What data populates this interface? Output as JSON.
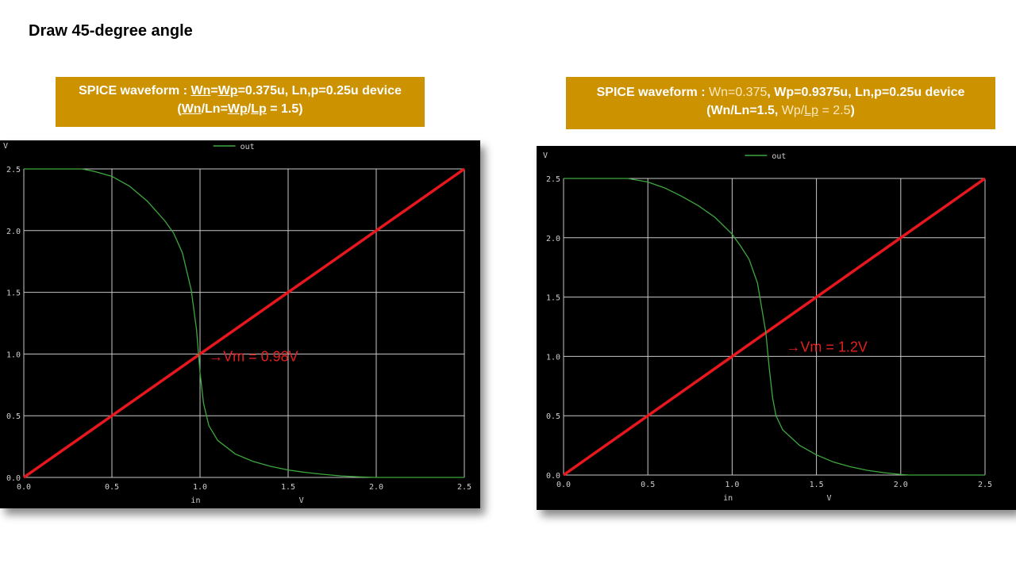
{
  "slide": {
    "title": "Draw 45-degree angle"
  },
  "captions": [
    {
      "line1_label": "SPICE waveform :",
      "line1_underlined": "Wn",
      "line1_mid": "=",
      "line1_underlined2": "Wp",
      "line1_rest": "=0.375u, Ln,p=0.25u device",
      "line2_open": "(",
      "line2_u1": "Wn",
      "line2_mid1": "/Ln=",
      "line2_u2": "Wp",
      "line2_mid2": "/",
      "line2_u3": "Lp",
      "line2_rest": " = 1.5)"
    },
    {
      "line1_label": "SPICE waveform :",
      "line1_light": " Wn=0.375",
      "line1_rest": ", Wp=0.9375u, Ln,p=0.25u device",
      "line2_a": "(Wn/Ln=1.5, ",
      "line2_light": "Wp/",
      "line2_u": "Lp",
      "line2_light2": " = 2.5",
      "line2_close": ")"
    }
  ],
  "colors": {
    "curve": "#3da83d",
    "diagonal": "#e8171e",
    "grid": "#c8c8c8",
    "background": "#000000",
    "caption_bg": "#cc9200"
  },
  "chart_data": [
    {
      "type": "line",
      "y_unit_label": "V",
      "x_unit_label": "V",
      "xlabel": "in",
      "legend": "out",
      "xlim": [
        0,
        2.5
      ],
      "ylim": [
        0,
        2.5
      ],
      "xticks": [
        "0.0",
        "0.5",
        "1.0",
        "1.5",
        "2.0",
        "2.5"
      ],
      "yticks": [
        "0.0",
        "0.5",
        "1.0",
        "1.5",
        "2.0",
        "2.5"
      ],
      "grid": true,
      "series": [
        {
          "name": "out",
          "x": [
            0.0,
            0.33,
            0.4,
            0.5,
            0.6,
            0.7,
            0.8,
            0.85,
            0.9,
            0.95,
            0.98,
            1.0,
            1.02,
            1.05,
            1.1,
            1.2,
            1.3,
            1.4,
            1.5,
            1.6,
            1.7,
            1.8,
            1.9,
            2.0,
            2.5
          ],
          "y": [
            2.5,
            2.5,
            2.48,
            2.44,
            2.36,
            2.24,
            2.08,
            1.98,
            1.82,
            1.52,
            1.2,
            0.85,
            0.6,
            0.42,
            0.3,
            0.19,
            0.13,
            0.09,
            0.06,
            0.04,
            0.025,
            0.012,
            0.005,
            0.0,
            0.0
          ]
        },
        {
          "name": "",
          "x": [
            0.0,
            2.5
          ],
          "y": [
            0.0,
            2.5
          ]
        }
      ],
      "annotation": "→Vm = 0.98V",
      "annotation_at": [
        1.05,
        0.98
      ]
    },
    {
      "type": "line",
      "y_unit_label": "V",
      "x_unit_label": "V",
      "xlabel": "in",
      "legend": "out",
      "xlim": [
        0,
        2.5
      ],
      "ylim": [
        0,
        2.5
      ],
      "xticks": [
        "0.0",
        "0.5",
        "1.0",
        "1.5",
        "2.0",
        "2.5"
      ],
      "yticks": [
        "0.0",
        "0.5",
        "1.0",
        "1.5",
        "2.0",
        "2.5"
      ],
      "grid": true,
      "series": [
        {
          "name": "out",
          "x": [
            0.0,
            0.38,
            0.5,
            0.6,
            0.7,
            0.8,
            0.9,
            1.0,
            1.05,
            1.1,
            1.15,
            1.2,
            1.22,
            1.24,
            1.26,
            1.3,
            1.4,
            1.5,
            1.6,
            1.7,
            1.8,
            1.9,
            2.0,
            2.05,
            2.5
          ],
          "y": [
            2.5,
            2.5,
            2.47,
            2.42,
            2.35,
            2.27,
            2.17,
            2.03,
            1.93,
            1.82,
            1.62,
            1.2,
            0.9,
            0.65,
            0.5,
            0.38,
            0.25,
            0.17,
            0.11,
            0.07,
            0.04,
            0.02,
            0.005,
            0.0,
            0.0
          ]
        },
        {
          "name": "",
          "x": [
            0.0,
            2.5
          ],
          "y": [
            0.0,
            2.5
          ]
        }
      ],
      "annotation": "→Vm = 1.2V",
      "annotation_at": [
        1.32,
        1.08
      ]
    }
  ]
}
